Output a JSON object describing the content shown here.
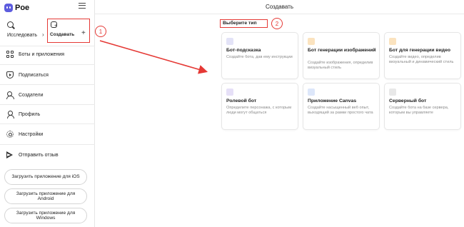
{
  "app": {
    "brand": "Poe"
  },
  "sidebar": {
    "explore_label": "Исследовать",
    "create_label": "Создавать",
    "items": [
      {
        "label": "Боты и приложения",
        "icon": "grid-icon"
      },
      {
        "label": "Подписаться",
        "icon": "shield-icon"
      },
      {
        "label": "Создатели",
        "icon": "people-icon"
      },
      {
        "label": "Профиль",
        "icon": "person-icon"
      },
      {
        "label": "Настройки",
        "icon": "gear-icon"
      },
      {
        "label": "Отправить отзыв",
        "icon": "send-icon"
      }
    ],
    "downloads": [
      "Загрузить приложение для iOS",
      "Загрузить приложение для Android",
      "Загрузить приложение для Windows"
    ]
  },
  "main": {
    "title": "Создавать",
    "choose_type": "Выберите тип",
    "cards": [
      {
        "title": "Бот-подсказка",
        "desc": "Создайте бота, дав ему инструкции",
        "icon": "prompt-icon",
        "color": "#7b7bd8"
      },
      {
        "title": "Бот генерации изображений",
        "desc": "Создайте изображения, определив визуальный стиль",
        "icon": "image-icon",
        "color": "#f0a030"
      },
      {
        "title": "Бот для генерации видео",
        "desc": "Создайте видео, определив визуальный и динамический стиль",
        "icon": "video-icon",
        "color": "#f0a030"
      },
      {
        "title": "Ролевой бот",
        "desc": "Определите персонажа, с которым люди могут общаться",
        "icon": "flag-icon",
        "color": "#8a7bd8"
      },
      {
        "title": "Приложение Canvas",
        "desc": "Создайте насыщенный веб опыт, выходящий за рамки простого чата",
        "icon": "canvas-icon",
        "color": "#5b8de8"
      },
      {
        "title": "Серверный бот",
        "desc": "Создайте бота на базе сервера, которым вы управляете",
        "icon": "monitor-icon",
        "color": "#444444"
      }
    ]
  },
  "annotations": {
    "step1": "1",
    "step2": "2"
  },
  "colors": {
    "accent": "#5d5cde",
    "annotation": "#e53935"
  }
}
